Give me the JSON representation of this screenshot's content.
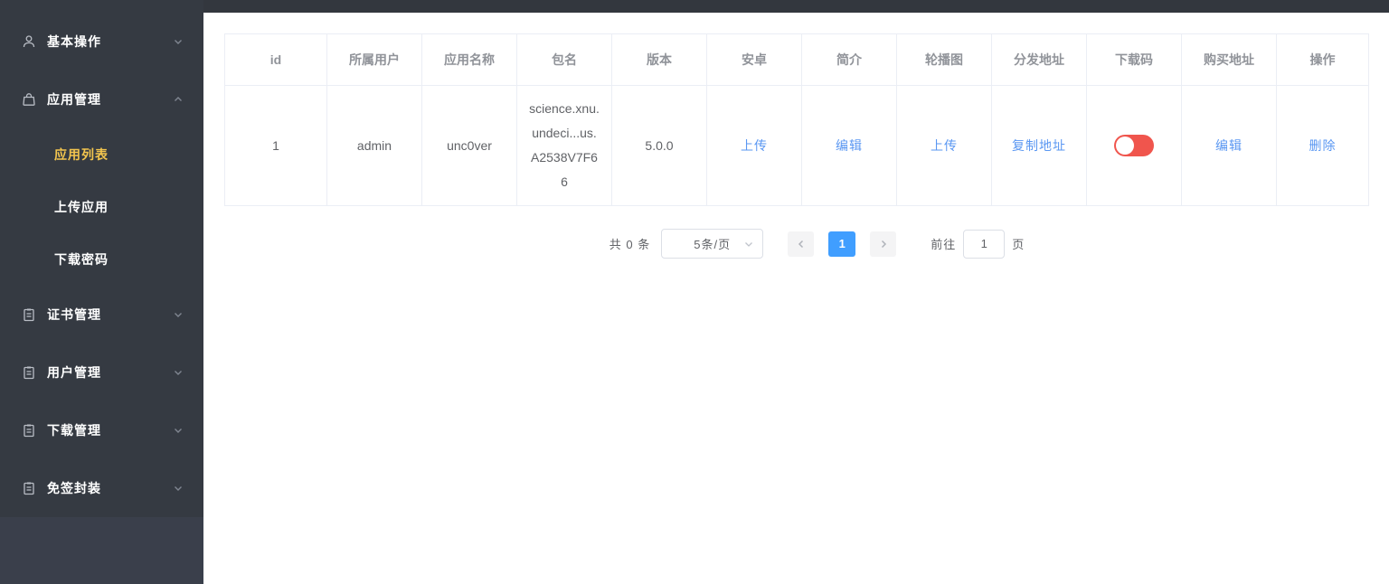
{
  "sidebar": {
    "items": [
      {
        "label": "基本操作",
        "icon": "user-icon",
        "chevron": "down",
        "expanded": false
      },
      {
        "label": "应用管理",
        "icon": "bag-icon",
        "chevron": "up",
        "expanded": true,
        "children": [
          {
            "label": "应用列表",
            "active": true
          },
          {
            "label": "上传应用",
            "active": false
          },
          {
            "label": "下载密码",
            "active": false
          }
        ]
      },
      {
        "label": "证书管理",
        "icon": "clipboard-icon",
        "chevron": "down",
        "expanded": false
      },
      {
        "label": "用户管理",
        "icon": "clipboard-icon",
        "chevron": "down",
        "expanded": false
      },
      {
        "label": "下载管理",
        "icon": "clipboard-icon",
        "chevron": "down",
        "expanded": false
      },
      {
        "label": "免签封装",
        "icon": "clipboard-icon",
        "chevron": "down",
        "expanded": false
      }
    ]
  },
  "table": {
    "headers": [
      "id",
      "所属用户",
      "应用名称",
      "包名",
      "版本",
      "安卓",
      "简介",
      "轮播图",
      "分发地址",
      "下载码",
      "购买地址",
      "操作"
    ],
    "rows": [
      {
        "id": "1",
        "owner": "admin",
        "app_name": "unc0ver",
        "package_name": "science.xnu.undeci...us.A2538V7F66",
        "version": "5.0.0",
        "android_link": "上传",
        "intro_link": "编辑",
        "carousel_link": "上传",
        "distribute_link": "复制地址",
        "download_code_toggle": {
          "state": "off",
          "color": "#f0554d"
        },
        "purchase_link": "编辑",
        "operation_link": "删除"
      }
    ]
  },
  "pagination": {
    "total_text": "共 0 条",
    "page_size_text": "5条/页",
    "current_page": "1",
    "goto_label": "前往",
    "goto_value": "1",
    "unit_label": "页"
  },
  "colors": {
    "sidebar_bg": "#353a42",
    "topbar_bg": "#33373e",
    "active_menu_text": "#f3c54e",
    "link_blue": "#5a97f2",
    "toggle_red": "#f0554d",
    "active_page_bg": "#409eff",
    "table_border": "#ebeef5",
    "header_text": "#909399",
    "body_text": "#606266"
  }
}
